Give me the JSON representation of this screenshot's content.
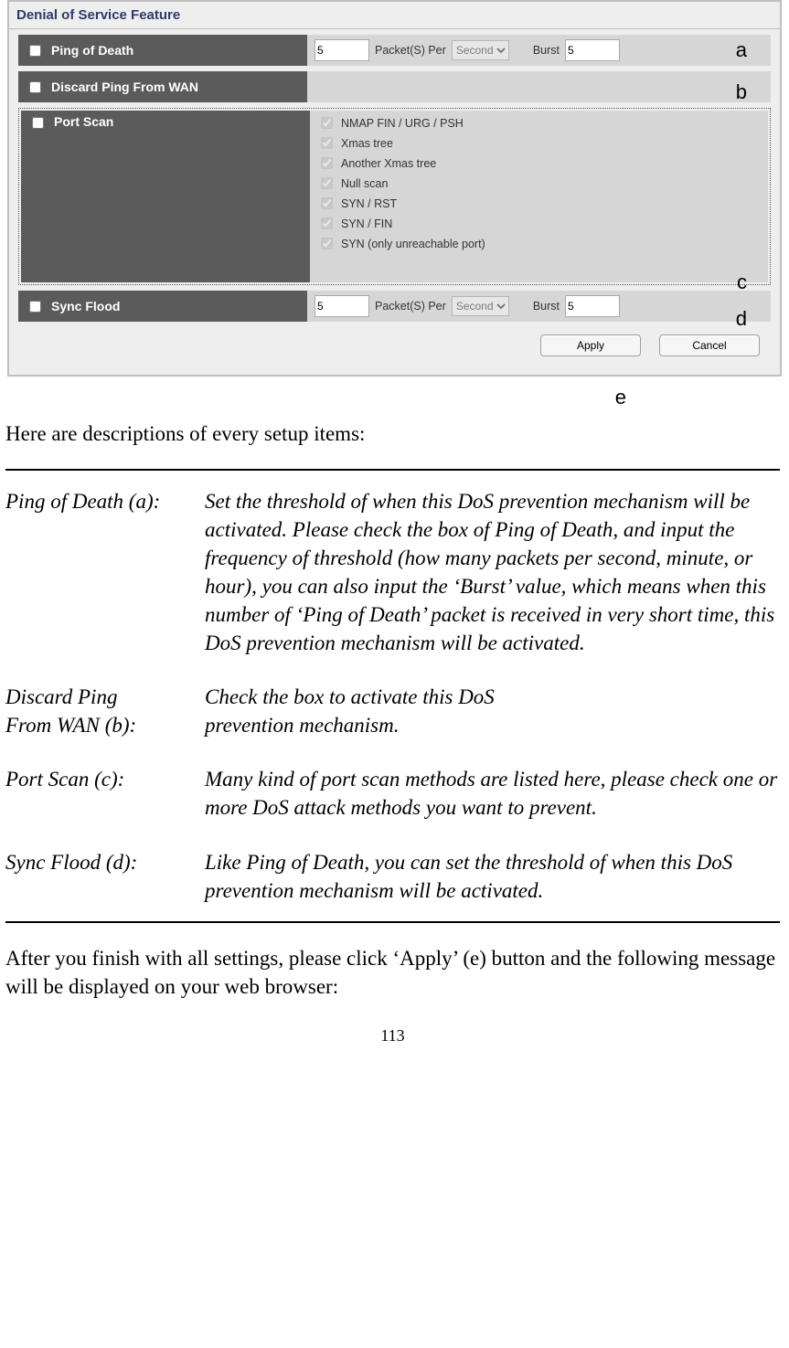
{
  "panel": {
    "title": "Denial of Service Feature",
    "rows": {
      "ping_of_death": {
        "label": "Ping of Death",
        "value": "5",
        "packets_per": "Packet(S) Per",
        "unit": "Second",
        "burst_label": "Burst",
        "burst_value": "5"
      },
      "discard_ping": {
        "label": "Discard Ping From WAN"
      },
      "port_scan": {
        "label": "Port Scan",
        "options": [
          "NMAP FIN / URG / PSH",
          "Xmas tree",
          "Another Xmas tree",
          "Null scan",
          "SYN / RST",
          "SYN / FIN",
          "SYN (only unreachable port)"
        ]
      },
      "sync_flood": {
        "label": "Sync Flood",
        "value": "5",
        "packets_per": "Packet(S) Per",
        "unit": "Second",
        "burst_label": "Burst",
        "burst_value": "5"
      }
    },
    "buttons": {
      "apply": "Apply",
      "cancel": "Cancel"
    }
  },
  "callouts": {
    "a": "a",
    "b": "b",
    "c": "c",
    "d": "d",
    "e": "e"
  },
  "doc": {
    "intro": "Here are descriptions of every setup items:",
    "items": [
      {
        "k": "Ping of Death (a):",
        "v": "Set the threshold of when this DoS prevention mechanism will be activated. Please check the box of Ping of Death, and input the frequency of threshold (how many packets per second, minute, or hour), you can also input the ‘Burst’ value, which means when this number of ‘Ping of Death’ packet is received in very short time, this DoS prevention mechanism will be activated."
      },
      {
        "k": "Discard Ping\nFrom WAN (b):",
        "v": "Check the box to activate this DoS\nprevention mechanism."
      },
      {
        "k": "Port Scan (c):",
        "v": "Many kind of port scan methods are listed here, please check one or more DoS attack methods you want to prevent."
      },
      {
        "k": "Sync Flood (d):",
        "v": "Like Ping of Death, you can set the threshold of when this DoS prevention mechanism will be activated."
      }
    ],
    "outro": "After you finish with all settings, please click ‘Apply’ (e) button and the following message will be displayed on your web browser:",
    "page_number": "113"
  }
}
